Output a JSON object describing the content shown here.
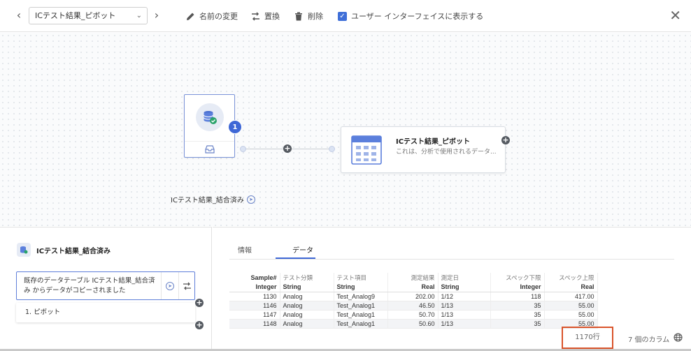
{
  "toolbar": {
    "recipe_name": "ICテスト結果_ピボット",
    "rename_label": "名前の変更",
    "replace_label": "置換",
    "delete_label": "削除",
    "show_in_ui_label": "ユーザー インターフェイスに表示する",
    "show_in_ui_checked": true
  },
  "canvas": {
    "source_node": {
      "label": "ICテスト結果_結合済み",
      "badge_count": "1"
    },
    "pivot_node": {
      "title": "ICテスト結果_ピボット",
      "description": "これは、分析で使用されるデータ..."
    }
  },
  "left_panel": {
    "title": "ICテスト結果_結合済み",
    "step_text": "既存のデータテーブル ICテスト結果_結合済み からデータがコピーされました",
    "pivot_step": "1. ピボット"
  },
  "right_panel": {
    "tabs": [
      {
        "label": "情報",
        "active": false
      },
      {
        "label": "データ",
        "active": true
      }
    ],
    "table": {
      "headers": [
        "Sample#",
        "テスト分類",
        "テスト項目",
        "測定結果",
        "測定日",
        "スペック下限",
        "スペック上限"
      ],
      "types": [
        "Integer",
        "String",
        "String",
        "Real",
        "String",
        "Integer",
        "Real"
      ],
      "rows": [
        [
          "1130",
          "Analog",
          "Test_Analog9",
          "202.00",
          "1/12",
          "118",
          "417.00"
        ],
        [
          "1146",
          "Analog",
          "Test_Analog1",
          "46.50",
          "1/13",
          "35",
          "55.00"
        ],
        [
          "1147",
          "Analog",
          "Test_Analog1",
          "50.70",
          "1/13",
          "35",
          "55.00"
        ],
        [
          "1148",
          "Analog",
          "Test_Analog1",
          "50.60",
          "1/13",
          "35",
          "55.00"
        ]
      ]
    },
    "row_count": "1170行",
    "column_count": "7 個のカラム"
  },
  "colors": {
    "accent": "#3e67d6",
    "highlight_border": "#d9532a"
  }
}
